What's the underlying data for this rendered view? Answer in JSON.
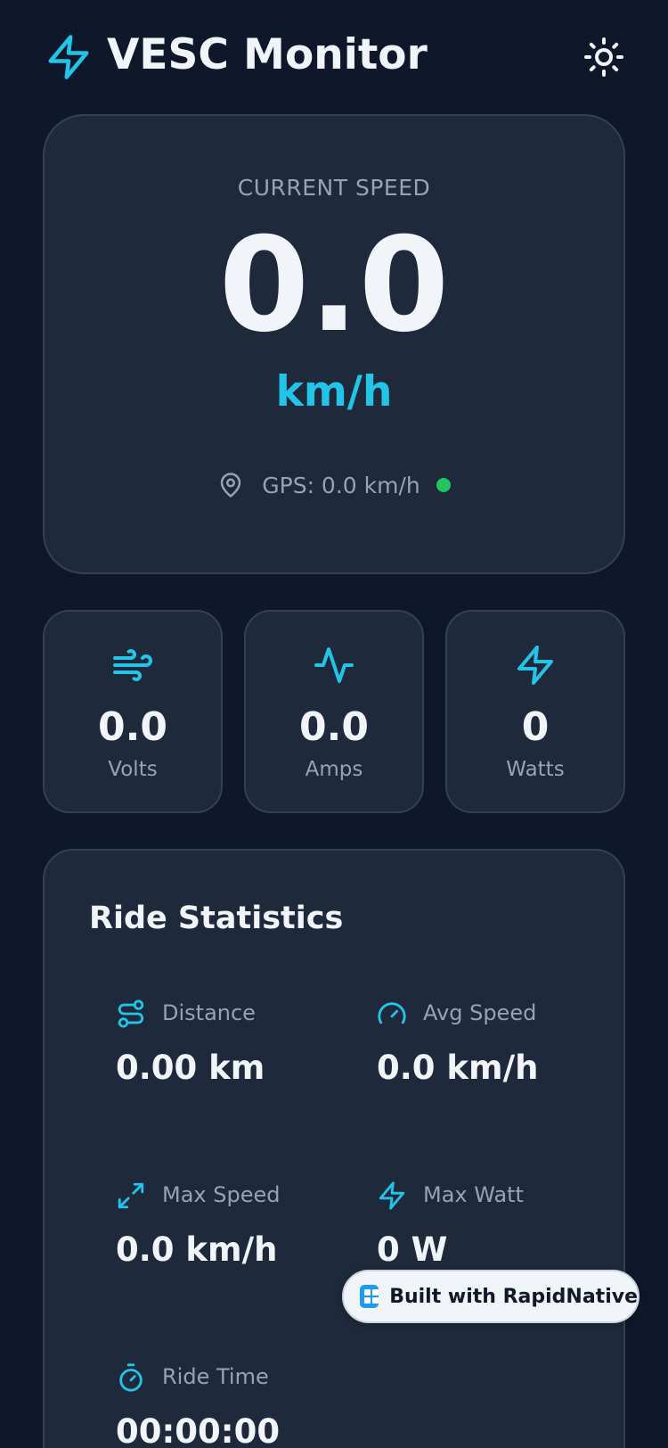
{
  "app": {
    "title": "VESC Monitor"
  },
  "speed": {
    "label": "CURRENT SPEED",
    "value": "0.0",
    "unit": "km/h",
    "gps_text": "GPS: 0.0 km/h",
    "gps_status_color": "#22c55e"
  },
  "metrics": [
    {
      "icon": "wind-icon",
      "value": "0.0",
      "label": "Volts"
    },
    {
      "icon": "activity-icon",
      "value": "0.0",
      "label": "Amps"
    },
    {
      "icon": "zap-icon",
      "value": "0",
      "label": "Watts"
    }
  ],
  "stats": {
    "title": "Ride Statistics",
    "items": [
      {
        "icon": "route-icon",
        "label": "Distance",
        "value": "0.00 km"
      },
      {
        "icon": "gauge-icon",
        "label": "Avg Speed",
        "value": "0.0 km/h"
      },
      {
        "icon": "maximize-icon",
        "label": "Max Speed",
        "value": "0.0 km/h"
      },
      {
        "icon": "zap-icon",
        "label": "Max Watt",
        "value": "0 W"
      },
      {
        "icon": "timer-icon",
        "label": "Ride Time",
        "value": "00:00:00"
      }
    ]
  },
  "badge": {
    "text": "Built with RapidNative"
  },
  "colors": {
    "background": "#0f172a",
    "card": "#1e293b",
    "accent": "#22c5e8",
    "text_primary": "#f1f5f9",
    "text_secondary": "#94a3b8"
  }
}
